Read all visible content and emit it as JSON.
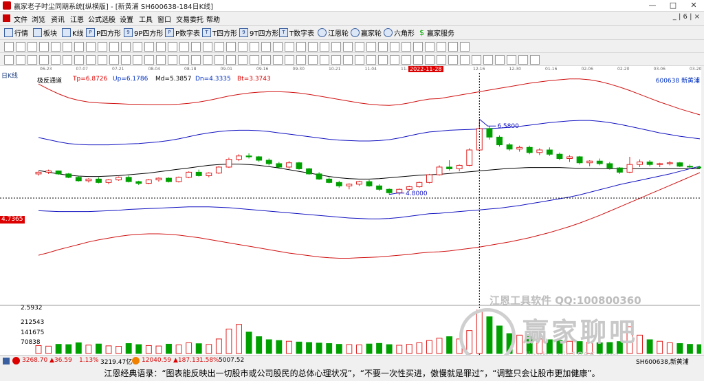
{
  "window": {
    "title": "赢家老子吋尘同期系统[纵横版] - [新黄浦  SH600638-184日K线]",
    "minimize": "—",
    "maximize": "□",
    "close": "✕"
  },
  "menu": {
    "items": [
      "文件",
      "浏览",
      "资讯",
      "江恩",
      "公式选股",
      "设置",
      "工具",
      "窗口",
      "交易委托",
      "帮助"
    ],
    "mdi_controls": "_ | 6 | ×"
  },
  "toolbar1": {
    "items": [
      "行情",
      "板块",
      "K线",
      "P四方形",
      "9P四方形",
      "P数字表",
      "T四方形",
      "9T四方形",
      "T数字表",
      "江恩轮",
      "赢家轮",
      "六角形",
      "赢家服务"
    ]
  },
  "chart_header": {
    "period_label": "日K线",
    "indicator_name": "极反通道",
    "tp": "Tp=6.8726",
    "up": "Up=6.1786",
    "md": "Md=5.3857",
    "dn": "Dn=4.3335",
    "bt": "Bt=3.3743",
    "stock_code": "600638",
    "stock_name": "新黄浦"
  },
  "date_axis": {
    "labels": [
      "06-23",
      "07-07",
      "07-21",
      "08-04",
      "08-18",
      "09-01",
      "09-16",
      "09-30",
      "10-21",
      "11-04",
      "11-18",
      "12",
      "12-16",
      "12-30",
      "01-16",
      "02-06",
      "02-20",
      "03-06",
      "03-20"
    ],
    "cursor_date": "2022-11-28"
  },
  "annotations": {
    "high_label": "6.5800",
    "low_label": "4.8000",
    "cursor_price": "4.7365"
  },
  "volume_axis": {
    "ticks": [
      "2.5932",
      "212543",
      "141675",
      "70838"
    ]
  },
  "watermark": {
    "line1": "江恩工具软件  QQ:100800360",
    "line2": "赢家聊吧",
    "line3": "liaoba.yjs1866.com"
  },
  "statusbar": {
    "sh_index": "3268.70",
    "sh_change": "▲36.59",
    "sh_pct": "1.13%",
    "sh_amount": "3219.47亿",
    "sz_index": "12040.59",
    "sz_change": "▲187.13",
    "sz_pct": "1.58%",
    "sz_amount": "5007.52",
    "stock": "SH600638,新黄浦"
  },
  "quote": "江恩经典语录：“图表能反映出一切股市或公司股民的总体心理状况”，“不要一次性买进，傲慢就是罪过”，“调整只会让股市更加健康”。",
  "colors": {
    "upper_band": "#d01010",
    "inner_band": "#1010c0",
    "mid_line": "#000000",
    "up_candle": "#e02020",
    "down_candle": "#00a000"
  },
  "chart_data": {
    "type": "candlestick",
    "period": "daily",
    "series": [
      {
        "name": "Tp",
        "values": [
          7.4,
          7.28,
          7.17,
          7.08,
          7.02,
          6.98,
          6.96,
          6.95,
          6.94,
          6.93,
          6.93,
          6.92,
          6.92,
          6.92,
          6.93,
          6.95,
          6.98,
          7.02,
          7.07,
          7.12,
          7.16,
          7.19,
          7.21,
          7.22,
          7.22,
          7.21,
          7.19,
          7.16,
          7.12,
          7.08,
          7.04,
          7.0,
          6.96,
          6.93,
          6.91,
          6.9,
          6.92,
          6.96,
          7.01,
          7.05,
          7.06,
          7.1,
          7.14,
          7.18,
          7.22,
          7.26,
          7.3,
          7.34,
          7.38,
          7.42,
          7.45,
          7.48,
          7.5,
          7.52,
          7.52,
          7.5,
          7.46,
          7.4,
          7.33,
          7.25,
          7.16,
          7.07,
          6.98,
          6.9,
          6.82,
          6.75,
          6.68
        ]
      },
      {
        "name": "Up",
        "values": [
          6.15,
          6.1,
          6.05,
          6.01,
          5.99,
          5.98,
          5.98,
          5.98,
          5.99,
          6.0,
          6.01,
          6.03,
          6.05,
          6.08,
          6.12,
          6.17,
          6.22,
          6.26,
          6.29,
          6.31,
          6.32,
          6.32,
          6.31,
          6.29,
          6.26,
          6.23,
          6.2,
          6.17,
          6.14,
          6.11,
          6.09,
          6.08,
          6.07,
          6.07,
          6.08,
          6.1,
          6.14,
          6.19,
          6.24,
          6.28,
          6.3,
          6.32,
          6.33,
          6.34,
          6.35,
          6.36,
          6.37,
          6.39,
          6.41,
          6.44,
          6.47,
          6.5,
          6.52,
          6.54,
          6.55,
          6.55,
          6.53,
          6.5,
          6.46,
          6.41,
          6.36,
          6.31,
          6.26,
          6.22,
          6.18,
          6.15,
          6.12
        ]
      },
      {
        "name": "Md",
        "values": [
          5.38,
          5.34,
          5.3,
          5.27,
          5.25,
          5.24,
          5.24,
          5.25,
          5.26,
          5.28,
          5.3,
          5.32,
          5.35,
          5.38,
          5.41,
          5.44,
          5.47,
          5.5,
          5.52,
          5.53,
          5.53,
          5.52,
          5.5,
          5.47,
          5.44,
          5.4,
          5.36,
          5.32,
          5.28,
          5.24,
          5.21,
          5.19,
          5.18,
          5.18,
          5.19,
          5.21,
          5.23,
          5.25,
          5.27,
          5.28,
          5.29,
          5.31,
          5.33,
          5.35,
          5.37,
          5.39,
          5.41,
          5.43,
          5.44,
          5.45,
          5.45,
          5.45,
          5.45,
          5.44,
          5.43,
          5.43,
          5.42,
          5.42,
          5.42,
          5.42,
          5.42,
          5.42,
          5.42,
          5.42,
          5.42,
          5.42,
          5.42
        ]
      },
      {
        "name": "Dn",
        "values": [
          4.44,
          4.43,
          4.42,
          4.42,
          4.42,
          4.42,
          4.43,
          4.44,
          4.45,
          4.47,
          4.48,
          4.49,
          4.5,
          4.51,
          4.52,
          4.53,
          4.53,
          4.53,
          4.52,
          4.51,
          4.49,
          4.47,
          4.45,
          4.43,
          4.41,
          4.39,
          4.37,
          4.35,
          4.33,
          4.31,
          4.29,
          4.27,
          4.26,
          4.25,
          4.25,
          4.26,
          4.28,
          4.31,
          4.34,
          4.37,
          4.38,
          4.4,
          4.42,
          4.44,
          4.46,
          4.48,
          4.5,
          4.53,
          4.56,
          4.6,
          4.64,
          4.68,
          4.72,
          4.76,
          4.81,
          4.87,
          4.93,
          4.99,
          5.05,
          5.1,
          5.15,
          5.2,
          5.25,
          5.3,
          5.36,
          5.42,
          5.48
        ]
      },
      {
        "name": "Bt",
        "values": [
          3.4,
          3.46,
          3.53,
          3.59,
          3.65,
          3.71,
          3.76,
          3.8,
          3.84,
          3.87,
          3.89,
          3.9,
          3.9,
          3.89,
          3.87,
          3.84,
          3.81,
          3.77,
          3.73,
          3.69,
          3.65,
          3.61,
          3.57,
          3.53,
          3.49,
          3.45,
          3.42,
          3.39,
          3.36,
          3.34,
          3.33,
          3.33,
          3.34,
          3.35,
          3.36,
          3.38,
          3.4,
          3.42,
          3.45,
          3.47,
          3.48,
          3.5,
          3.53,
          3.56,
          3.59,
          3.63,
          3.67,
          3.71,
          3.76,
          3.81,
          3.87,
          3.93,
          4.0,
          4.07,
          4.15,
          4.24,
          4.33,
          4.43,
          4.53,
          4.63,
          4.73,
          4.83,
          4.93,
          5.03,
          5.13,
          5.23,
          5.33
        ]
      }
    ],
    "candles": [
      [
        5.3,
        5.36,
        5.26,
        5.34
      ],
      [
        5.34,
        5.4,
        5.3,
        5.37
      ],
      [
        5.37,
        5.38,
        5.28,
        5.3
      ],
      [
        5.3,
        5.32,
        5.2,
        5.22
      ],
      [
        5.22,
        5.25,
        5.12,
        5.14
      ],
      [
        5.14,
        5.2,
        5.1,
        5.18
      ],
      [
        5.18,
        5.22,
        5.08,
        5.1
      ],
      [
        5.1,
        5.18,
        5.06,
        5.16
      ],
      [
        5.16,
        5.24,
        5.14,
        5.22
      ],
      [
        5.22,
        5.26,
        5.1,
        5.12
      ],
      [
        5.12,
        5.14,
        5.04,
        5.08
      ],
      [
        5.08,
        5.18,
        5.06,
        5.16
      ],
      [
        5.16,
        5.22,
        5.12,
        5.2
      ],
      [
        5.2,
        5.22,
        5.1,
        5.12
      ],
      [
        5.12,
        5.24,
        5.1,
        5.22
      ],
      [
        5.22,
        5.36,
        5.2,
        5.34
      ],
      [
        5.34,
        5.4,
        5.24,
        5.26
      ],
      [
        5.26,
        5.34,
        5.22,
        5.32
      ],
      [
        5.32,
        5.48,
        5.3,
        5.46
      ],
      [
        5.46,
        5.68,
        5.44,
        5.64
      ],
      [
        5.64,
        5.76,
        5.6,
        5.72
      ],
      [
        5.72,
        5.78,
        5.66,
        5.7
      ],
      [
        5.7,
        5.72,
        5.58,
        5.62
      ],
      [
        5.62,
        5.66,
        5.5,
        5.54
      ],
      [
        5.54,
        5.58,
        5.42,
        5.46
      ],
      [
        5.46,
        5.6,
        5.42,
        5.56
      ],
      [
        5.56,
        5.58,
        5.4,
        5.42
      ],
      [
        5.42,
        5.44,
        5.28,
        5.3
      ],
      [
        5.3,
        5.34,
        5.16,
        5.18
      ],
      [
        5.18,
        5.22,
        5.08,
        5.1
      ],
      [
        5.1,
        5.14,
        4.98,
        5.02
      ],
      [
        5.02,
        5.08,
        4.94,
        5.06
      ],
      [
        5.06,
        5.14,
        5.02,
        5.12
      ],
      [
        5.12,
        5.16,
        5.0,
        5.02
      ],
      [
        5.02,
        5.06,
        4.9,
        4.94
      ],
      [
        4.94,
        4.96,
        4.82,
        4.86
      ],
      [
        4.86,
        4.96,
        4.8,
        4.94
      ],
      [
        4.94,
        5.02,
        4.9,
        5.0
      ],
      [
        5.0,
        5.12,
        4.98,
        5.1
      ],
      [
        5.1,
        5.3,
        5.08,
        5.28
      ],
      [
        5.28,
        5.5,
        5.26,
        5.46
      ],
      [
        5.46,
        5.62,
        5.38,
        5.42
      ],
      [
        5.42,
        5.52,
        5.36,
        5.5
      ],
      [
        5.5,
        5.9,
        5.48,
        5.86
      ],
      [
        5.86,
        6.58,
        5.84,
        6.36
      ],
      [
        6.36,
        6.42,
        6.1,
        6.16
      ],
      [
        6.16,
        6.2,
        5.94,
        5.98
      ],
      [
        5.98,
        6.02,
        5.84,
        5.88
      ],
      [
        5.88,
        5.96,
        5.82,
        5.92
      ],
      [
        5.92,
        5.96,
        5.76,
        5.8
      ],
      [
        5.8,
        5.9,
        5.74,
        5.86
      ],
      [
        5.86,
        5.92,
        5.72,
        5.76
      ],
      [
        5.76,
        5.8,
        5.62,
        5.66
      ],
      [
        5.66,
        5.74,
        5.58,
        5.7
      ],
      [
        5.7,
        5.72,
        5.52,
        5.56
      ],
      [
        5.56,
        5.62,
        5.48,
        5.6
      ],
      [
        5.6,
        5.66,
        5.5,
        5.54
      ],
      [
        5.54,
        5.58,
        5.4,
        5.44
      ],
      [
        5.44,
        5.46,
        5.3,
        5.34
      ],
      [
        5.34,
        5.7,
        5.32,
        5.52
      ],
      [
        5.52,
        5.64,
        5.46,
        5.58
      ],
      [
        5.58,
        5.62,
        5.48,
        5.52
      ],
      [
        5.52,
        5.56,
        5.46,
        5.54
      ],
      [
        5.54,
        5.6,
        5.5,
        5.56
      ],
      [
        5.56,
        5.58,
        5.46,
        5.48
      ],
      [
        5.48,
        5.52,
        5.44,
        5.46
      ],
      [
        5.46,
        5.48,
        5.42,
        5.44
      ]
    ],
    "volume_max": 283400,
    "volumes": [
      52000,
      48000,
      60000,
      58000,
      70000,
      55000,
      62000,
      50000,
      47000,
      65000,
      58000,
      52000,
      49000,
      61000,
      56000,
      70000,
      64000,
      59000,
      95000,
      160000,
      190000,
      140000,
      110000,
      90000,
      85000,
      80000,
      75000,
      72000,
      68000,
      65000,
      60000,
      58000,
      56000,
      62000,
      66000,
      58000,
      54000,
      60000,
      70000,
      85000,
      100000,
      110000,
      95000,
      150000,
      283400,
      240000,
      180000,
      130000,
      120000,
      110000,
      95000,
      90000,
      85000,
      80000,
      78000,
      74000,
      70000,
      72000,
      78000,
      175000,
      120000,
      90000,
      80000,
      70000,
      65000,
      60000,
      58000
    ],
    "xlabel": "",
    "ylabel": "",
    "ylim": [
      3.0,
      7.5
    ],
    "cursor_index": 44,
    "high_index": 44,
    "low_index": 35,
    "cursor_price_value": 4.7365
  }
}
